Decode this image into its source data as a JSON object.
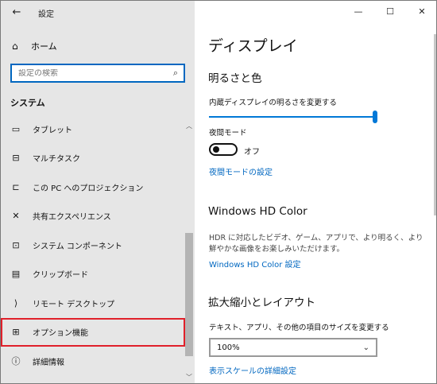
{
  "window": {
    "title": "設定",
    "controls": {
      "minimize": "—",
      "maximize": "☐",
      "close": "✕"
    }
  },
  "sidebar": {
    "back_icon": "←",
    "home": {
      "icon": "⌂",
      "label": "ホーム"
    },
    "search": {
      "placeholder": "設定の検索",
      "icon": "⌕"
    },
    "section": "システム",
    "items": [
      {
        "icon": "▭",
        "label": "タブレット"
      },
      {
        "icon": "⊟",
        "label": "マルチタスク"
      },
      {
        "icon": "⊏",
        "label": "この PC へのプロジェクション"
      },
      {
        "icon": "✕",
        "label": "共有エクスペリエンス"
      },
      {
        "icon": "⊡",
        "label": "システム コンポーネント"
      },
      {
        "icon": "▤",
        "label": "クリップボード"
      },
      {
        "icon": "⟩",
        "label": "リモート デスクトップ"
      },
      {
        "icon": "⊞",
        "label": "オプション機能"
      },
      {
        "icon": "ⓘ",
        "label": "詳細情報"
      }
    ],
    "highlighted": "オプション機能"
  },
  "content": {
    "page_title": "ディスプレイ",
    "brightness": {
      "heading": "明るさと色",
      "slider_label": "内蔵ディスプレイの明るさを変更する",
      "slider_value": 1.0,
      "night_mode_label": "夜間モード",
      "toggle_state": "オフ",
      "night_mode_link": "夜間モードの設定"
    },
    "hdr": {
      "heading": "Windows HD Color",
      "description": "HDR に対応したビデオ、ゲーム、アプリで、より明るく、より鮮やかな画像をお楽しみいただけます。",
      "link": "Windows HD Color 設定"
    },
    "scale": {
      "heading": "拡大縮小とレイアウト",
      "label": "テキスト、アプリ、その他の項目のサイズを変更する",
      "selected": "100%",
      "link": "表示スケールの詳細設定"
    }
  },
  "colors": {
    "accent": "#0078d7",
    "link": "#0067c0",
    "highlight_border": "#e0202a",
    "sidebar_bg": "#e6e6e6"
  }
}
